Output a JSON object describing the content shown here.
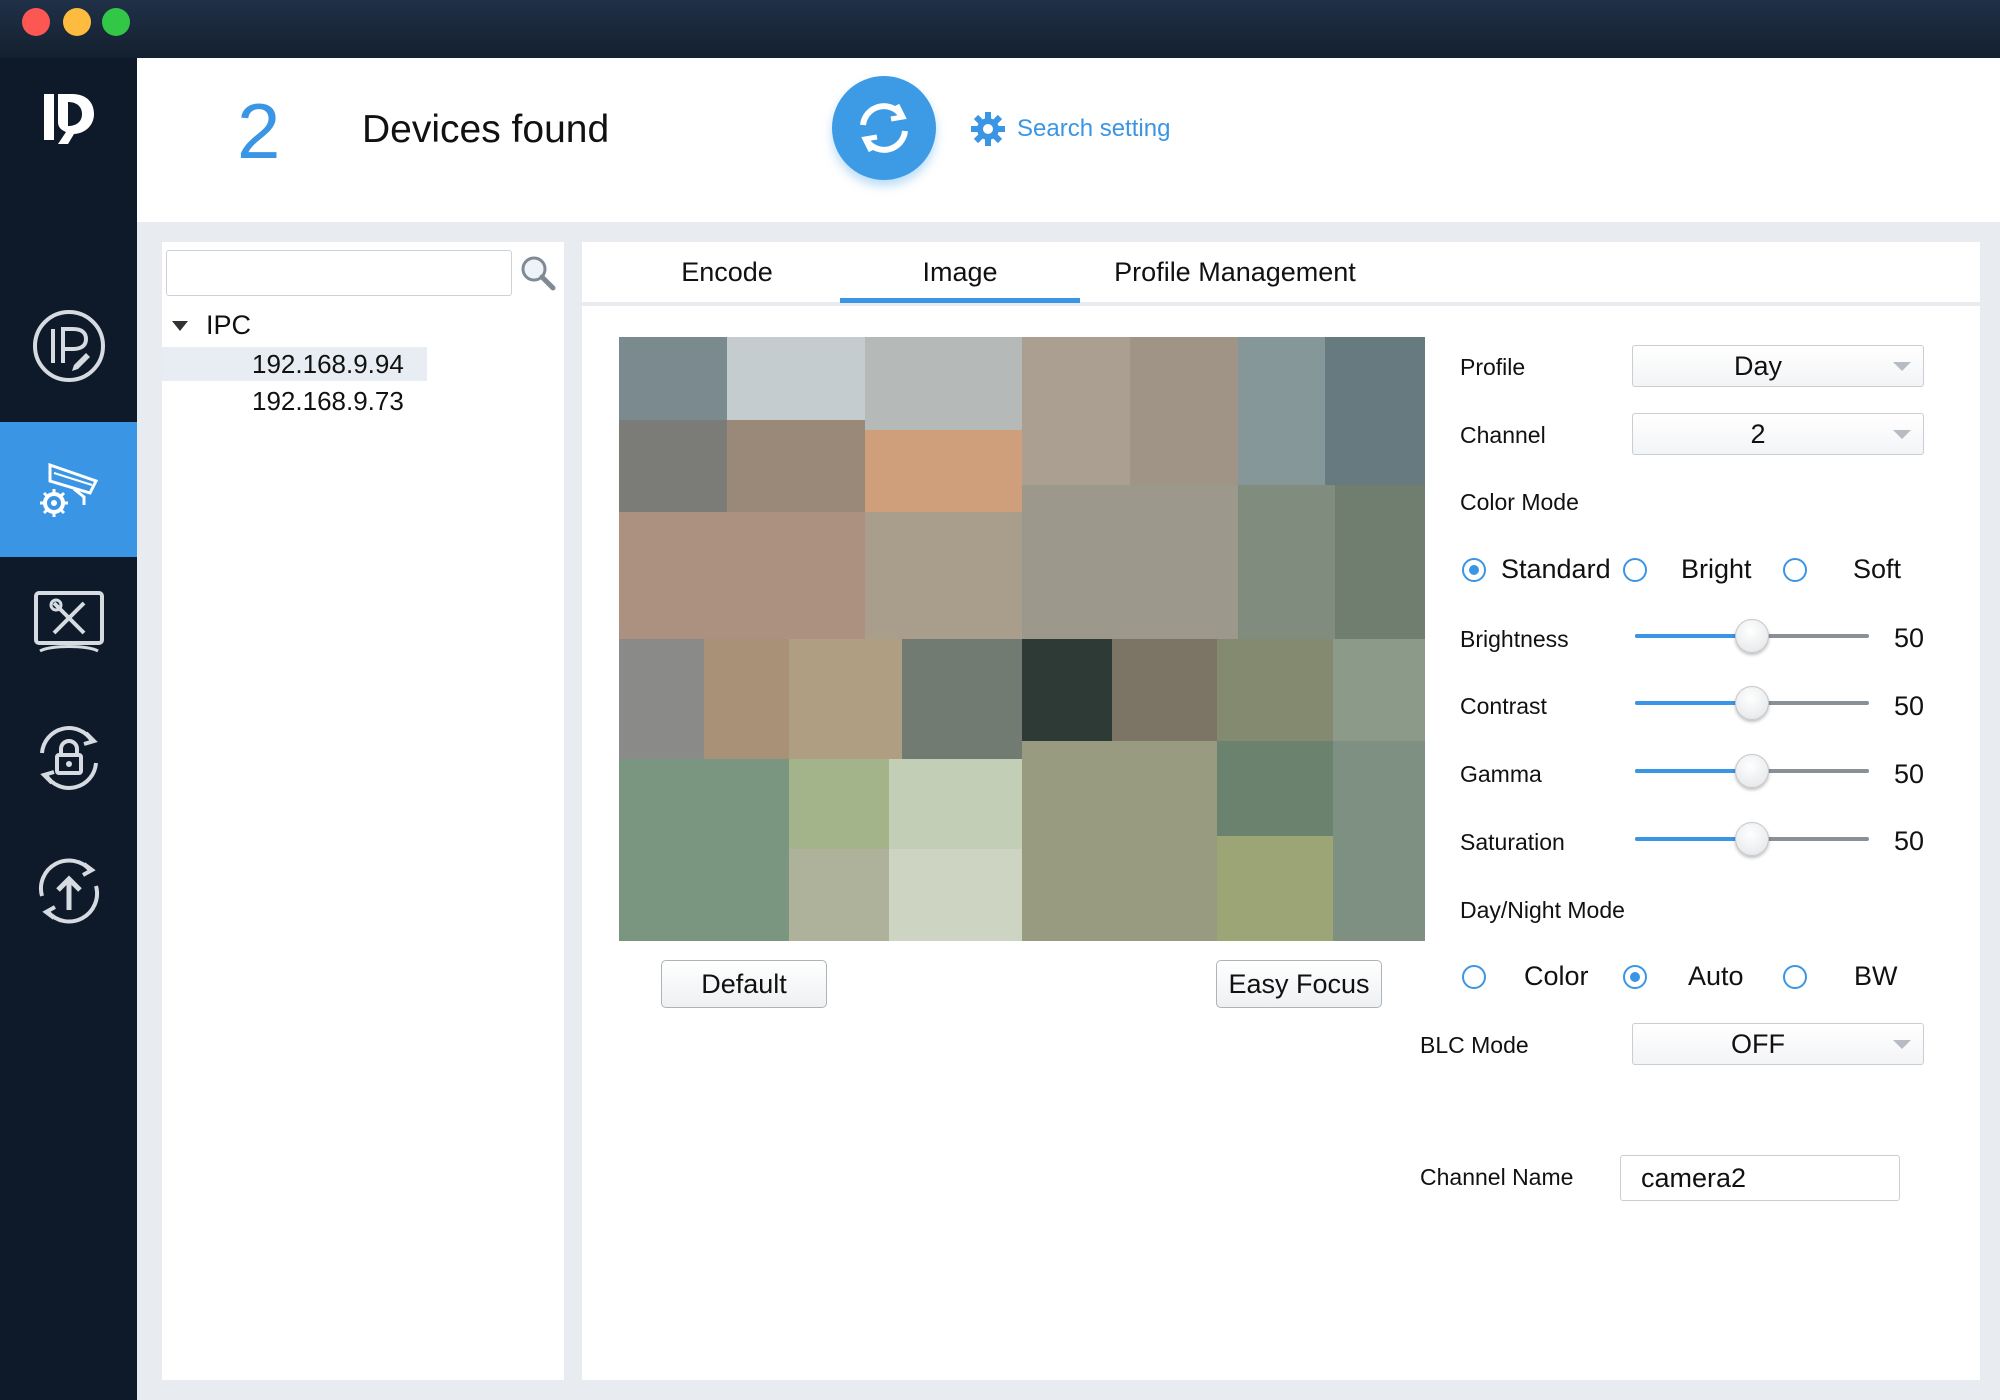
{
  "header": {
    "device_count": "2",
    "devices_found_label": "Devices found",
    "search_setting_label": "Search setting"
  },
  "sidebar": {
    "items": [
      {
        "icon": "ip-config-icon"
      },
      {
        "icon": "camera-settings-icon",
        "active": true
      },
      {
        "icon": "system-tools-icon"
      },
      {
        "icon": "password-reset-icon"
      },
      {
        "icon": "upgrade-icon"
      }
    ]
  },
  "tree": {
    "search_value": "",
    "root_label": "IPC",
    "nodes": [
      "192.168.9.94",
      "192.168.9.73"
    ],
    "selected": "192.168.9.94"
  },
  "tabs": [
    {
      "label": "Encode"
    },
    {
      "label": "Image",
      "active": true
    },
    {
      "label": "Profile Management"
    }
  ],
  "preview": {
    "default_button": "Default",
    "easy_focus_button": "Easy Focus"
  },
  "settings": {
    "profile_label": "Profile",
    "profile_value": "Day",
    "channel_label": "Channel",
    "channel_value": "2",
    "color_mode_label": "Color Mode",
    "color_mode_options": [
      "Standard",
      "Bright",
      "Soft"
    ],
    "color_mode_selected": "Standard",
    "sliders": [
      {
        "label": "Brightness",
        "value": 50
      },
      {
        "label": "Contrast",
        "value": 50
      },
      {
        "label": "Gamma",
        "value": 50
      },
      {
        "label": "Saturation",
        "value": 50
      }
    ],
    "day_night_label": "Day/Night Mode",
    "day_night_options": [
      "Color",
      "Auto",
      "BW"
    ],
    "day_night_selected": "Auto",
    "blc_label": "BLC Mode",
    "blc_value": "OFF",
    "channel_name_label": "Channel Name",
    "channel_name_value": "camera2"
  },
  "colors": {
    "accent": "#3a95e4",
    "sidebar_bg": "#0e1a29",
    "panel_bg": "#ffffff",
    "workspace_bg": "#e8ebef"
  }
}
